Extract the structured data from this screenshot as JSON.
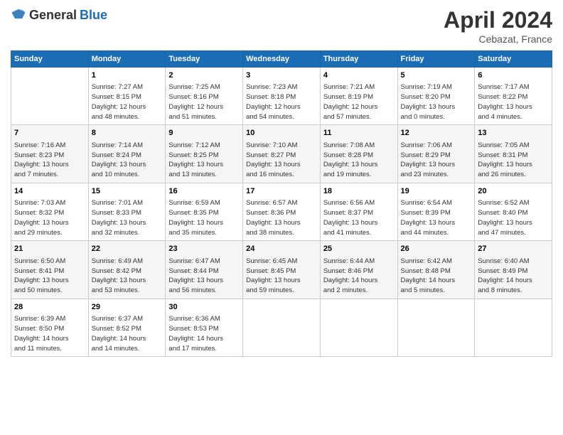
{
  "header": {
    "logo_general": "General",
    "logo_blue": "Blue",
    "title": "April 2024",
    "subtitle": "Cebazat, France"
  },
  "days_of_week": [
    "Sunday",
    "Monday",
    "Tuesday",
    "Wednesday",
    "Thursday",
    "Friday",
    "Saturday"
  ],
  "weeks": [
    [
      {
        "day": "",
        "content": ""
      },
      {
        "day": "1",
        "content": "Sunrise: 7:27 AM\nSunset: 8:15 PM\nDaylight: 12 hours\nand 48 minutes."
      },
      {
        "day": "2",
        "content": "Sunrise: 7:25 AM\nSunset: 8:16 PM\nDaylight: 12 hours\nand 51 minutes."
      },
      {
        "day": "3",
        "content": "Sunrise: 7:23 AM\nSunset: 8:18 PM\nDaylight: 12 hours\nand 54 minutes."
      },
      {
        "day": "4",
        "content": "Sunrise: 7:21 AM\nSunset: 8:19 PM\nDaylight: 12 hours\nand 57 minutes."
      },
      {
        "day": "5",
        "content": "Sunrise: 7:19 AM\nSunset: 8:20 PM\nDaylight: 13 hours\nand 0 minutes."
      },
      {
        "day": "6",
        "content": "Sunrise: 7:17 AM\nSunset: 8:22 PM\nDaylight: 13 hours\nand 4 minutes."
      }
    ],
    [
      {
        "day": "7",
        "content": "Sunrise: 7:16 AM\nSunset: 8:23 PM\nDaylight: 13 hours\nand 7 minutes."
      },
      {
        "day": "8",
        "content": "Sunrise: 7:14 AM\nSunset: 8:24 PM\nDaylight: 13 hours\nand 10 minutes."
      },
      {
        "day": "9",
        "content": "Sunrise: 7:12 AM\nSunset: 8:25 PM\nDaylight: 13 hours\nand 13 minutes."
      },
      {
        "day": "10",
        "content": "Sunrise: 7:10 AM\nSunset: 8:27 PM\nDaylight: 13 hours\nand 16 minutes."
      },
      {
        "day": "11",
        "content": "Sunrise: 7:08 AM\nSunset: 8:28 PM\nDaylight: 13 hours\nand 19 minutes."
      },
      {
        "day": "12",
        "content": "Sunrise: 7:06 AM\nSunset: 8:29 PM\nDaylight: 13 hours\nand 23 minutes."
      },
      {
        "day": "13",
        "content": "Sunrise: 7:05 AM\nSunset: 8:31 PM\nDaylight: 13 hours\nand 26 minutes."
      }
    ],
    [
      {
        "day": "14",
        "content": "Sunrise: 7:03 AM\nSunset: 8:32 PM\nDaylight: 13 hours\nand 29 minutes."
      },
      {
        "day": "15",
        "content": "Sunrise: 7:01 AM\nSunset: 8:33 PM\nDaylight: 13 hours\nand 32 minutes."
      },
      {
        "day": "16",
        "content": "Sunrise: 6:59 AM\nSunset: 8:35 PM\nDaylight: 13 hours\nand 35 minutes."
      },
      {
        "day": "17",
        "content": "Sunrise: 6:57 AM\nSunset: 8:36 PM\nDaylight: 13 hours\nand 38 minutes."
      },
      {
        "day": "18",
        "content": "Sunrise: 6:56 AM\nSunset: 8:37 PM\nDaylight: 13 hours\nand 41 minutes."
      },
      {
        "day": "19",
        "content": "Sunrise: 6:54 AM\nSunset: 8:39 PM\nDaylight: 13 hours\nand 44 minutes."
      },
      {
        "day": "20",
        "content": "Sunrise: 6:52 AM\nSunset: 8:40 PM\nDaylight: 13 hours\nand 47 minutes."
      }
    ],
    [
      {
        "day": "21",
        "content": "Sunrise: 6:50 AM\nSunset: 8:41 PM\nDaylight: 13 hours\nand 50 minutes."
      },
      {
        "day": "22",
        "content": "Sunrise: 6:49 AM\nSunset: 8:42 PM\nDaylight: 13 hours\nand 53 minutes."
      },
      {
        "day": "23",
        "content": "Sunrise: 6:47 AM\nSunset: 8:44 PM\nDaylight: 13 hours\nand 56 minutes."
      },
      {
        "day": "24",
        "content": "Sunrise: 6:45 AM\nSunset: 8:45 PM\nDaylight: 13 hours\nand 59 minutes."
      },
      {
        "day": "25",
        "content": "Sunrise: 6:44 AM\nSunset: 8:46 PM\nDaylight: 14 hours\nand 2 minutes."
      },
      {
        "day": "26",
        "content": "Sunrise: 6:42 AM\nSunset: 8:48 PM\nDaylight: 14 hours\nand 5 minutes."
      },
      {
        "day": "27",
        "content": "Sunrise: 6:40 AM\nSunset: 8:49 PM\nDaylight: 14 hours\nand 8 minutes."
      }
    ],
    [
      {
        "day": "28",
        "content": "Sunrise: 6:39 AM\nSunset: 8:50 PM\nDaylight: 14 hours\nand 11 minutes."
      },
      {
        "day": "29",
        "content": "Sunrise: 6:37 AM\nSunset: 8:52 PM\nDaylight: 14 hours\nand 14 minutes."
      },
      {
        "day": "30",
        "content": "Sunrise: 6:36 AM\nSunset: 8:53 PM\nDaylight: 14 hours\nand 17 minutes."
      },
      {
        "day": "",
        "content": ""
      },
      {
        "day": "",
        "content": ""
      },
      {
        "day": "",
        "content": ""
      },
      {
        "day": "",
        "content": ""
      }
    ]
  ]
}
